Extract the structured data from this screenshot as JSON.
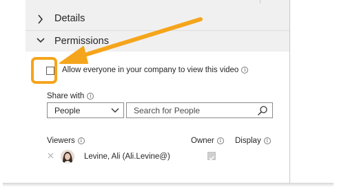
{
  "sections": {
    "details_label": "Details",
    "permissions_label": "Permissions"
  },
  "permissions": {
    "allow_everyone_label": "Allow everyone in your company to view this video",
    "allow_everyone_checked": false,
    "share_with_label": "Share with",
    "share_with_selected": "People",
    "search_placeholder": "Search for People"
  },
  "viewers": {
    "viewers_header": "Viewers",
    "owner_header": "Owner",
    "display_header": "Display",
    "rows": [
      {
        "name": "Levine, Ali (Ali.Levine@)",
        "owner": true
      }
    ]
  },
  "icons": {
    "info": "i",
    "expand": "chevron-right-icon",
    "collapse": "chevron-down-icon",
    "search": "search-icon",
    "remove": "close-icon"
  },
  "colors": {
    "annotation": "#f5a51b",
    "header_bg": "#f0f0f0"
  }
}
